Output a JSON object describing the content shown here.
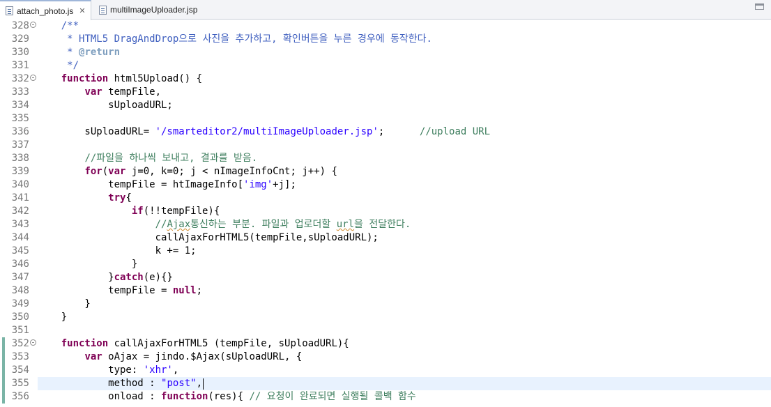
{
  "tabs": [
    {
      "label": "attach_photo.js",
      "close": "✕"
    },
    {
      "label": "multiImageUploader.jsp"
    }
  ],
  "colors": {
    "keyword": "#7f0055",
    "string": "#2a00ff",
    "comment": "#3f7f5f",
    "javadoc": "#3f5fbf",
    "current_line": "#e8f2fe",
    "change_bar": "#7ab4a6"
  },
  "editor": {
    "lines": [
      {
        "n": "328",
        "t": [
          [
            "    ",
            ""
          ],
          [
            "/**",
            "doc"
          ]
        ]
      },
      {
        "n": "329",
        "t": [
          [
            "     ",
            ""
          ],
          [
            "* HTML5 DragAndDrop으로 사진을 추가하고, 확인버튼을 누른 경우에 동작한다.",
            "doc"
          ]
        ]
      },
      {
        "n": "330",
        "t": [
          [
            "     ",
            ""
          ],
          [
            "* ",
            "doc"
          ],
          [
            "@return",
            "tag"
          ]
        ]
      },
      {
        "n": "331",
        "t": [
          [
            "     ",
            ""
          ],
          [
            "*/",
            "doc"
          ]
        ]
      },
      {
        "n": "332",
        "t": [
          [
            "    ",
            ""
          ],
          [
            "function",
            "kw"
          ],
          [
            " html5Upload() {",
            ""
          ]
        ]
      },
      {
        "n": "333",
        "t": [
          [
            "        ",
            ""
          ],
          [
            "var",
            "kw"
          ],
          [
            " tempFile,",
            ""
          ]
        ]
      },
      {
        "n": "334",
        "t": [
          [
            "            sUploadURL;",
            ""
          ]
        ]
      },
      {
        "n": "335",
        "t": []
      },
      {
        "n": "336",
        "t": [
          [
            "        sUploadURL= ",
            ""
          ],
          [
            "'/smarteditor2/multiImageUploader.jsp'",
            "str"
          ],
          [
            ";      ",
            ""
          ],
          [
            "//upload URL",
            "cm"
          ]
        ]
      },
      {
        "n": "337",
        "t": []
      },
      {
        "n": "338",
        "t": [
          [
            "        ",
            ""
          ],
          [
            "//파일을 하나씩 보내고, 결과를 받음.",
            "cm"
          ]
        ]
      },
      {
        "n": "339",
        "t": [
          [
            "        ",
            ""
          ],
          [
            "for",
            "kw"
          ],
          [
            "(",
            ""
          ],
          [
            "var",
            "kw"
          ],
          [
            " j=0, k=0; j < nImageInfoCnt; j++) {",
            ""
          ]
        ]
      },
      {
        "n": "340",
        "t": [
          [
            "            tempFile = htImageInfo[",
            ""
          ],
          [
            "'img'",
            "str"
          ],
          [
            "+j];",
            ""
          ]
        ]
      },
      {
        "n": "341",
        "t": [
          [
            "            ",
            ""
          ],
          [
            "try",
            "kw"
          ],
          [
            "{",
            ""
          ]
        ]
      },
      {
        "n": "342",
        "t": [
          [
            "                ",
            ""
          ],
          [
            "if",
            "kw"
          ],
          [
            "(!!tempFile){",
            ""
          ]
        ]
      },
      {
        "n": "343",
        "t": [
          [
            "                    ",
            ""
          ],
          [
            "//",
            "cm"
          ],
          [
            "Ajax",
            "cm sq"
          ],
          [
            "통신하는 부분. 파일과 업로더할 ",
            "cm"
          ],
          [
            "url",
            "cm sq"
          ],
          [
            "을 전달한다.",
            "cm"
          ]
        ]
      },
      {
        "n": "344",
        "t": [
          [
            "                    callAjaxForHTML5(tempFile,sUploadURL);",
            ""
          ]
        ]
      },
      {
        "n": "345",
        "t": [
          [
            "                    k += 1;",
            ""
          ]
        ]
      },
      {
        "n": "346",
        "t": [
          [
            "                }",
            ""
          ]
        ]
      },
      {
        "n": "347",
        "t": [
          [
            "            }",
            ""
          ],
          [
            "catch",
            "kw"
          ],
          [
            "(e){}",
            ""
          ]
        ]
      },
      {
        "n": "348",
        "t": [
          [
            "            tempFile = ",
            ""
          ],
          [
            "null",
            "kw"
          ],
          [
            ";",
            ""
          ]
        ]
      },
      {
        "n": "349",
        "t": [
          [
            "        }",
            ""
          ]
        ]
      },
      {
        "n": "350",
        "t": [
          [
            "    }",
            ""
          ]
        ]
      },
      {
        "n": "351",
        "t": []
      },
      {
        "n": "352",
        "t": [
          [
            "    ",
            ""
          ],
          [
            "function",
            "kw"
          ],
          [
            " callAjaxForHTML5 (tempFile, sUploadURL){",
            ""
          ]
        ]
      },
      {
        "n": "353",
        "t": [
          [
            "        ",
            ""
          ],
          [
            "var",
            "kw"
          ],
          [
            " oAjax = jindo.$Ajax(sUploadURL, {",
            ""
          ]
        ]
      },
      {
        "n": "354",
        "t": [
          [
            "            type: ",
            ""
          ],
          [
            "'xhr'",
            "str"
          ],
          [
            ",",
            ""
          ]
        ]
      },
      {
        "n": "355",
        "t": [
          [
            "            method : ",
            ""
          ],
          [
            "\"post\"",
            "str"
          ],
          [
            ",",
            ""
          ]
        ]
      },
      {
        "n": "356",
        "t": [
          [
            "            onload : ",
            ""
          ],
          [
            "function",
            "kw"
          ],
          [
            "(res){ ",
            ""
          ],
          [
            "// 요청이 완료되면 실행될 콜백 함수",
            "cm"
          ]
        ]
      }
    ],
    "folds": [
      "328",
      "332",
      "352"
    ],
    "changed_lines": [
      "352",
      "353",
      "354",
      "355",
      "356"
    ],
    "current_line": "355"
  }
}
